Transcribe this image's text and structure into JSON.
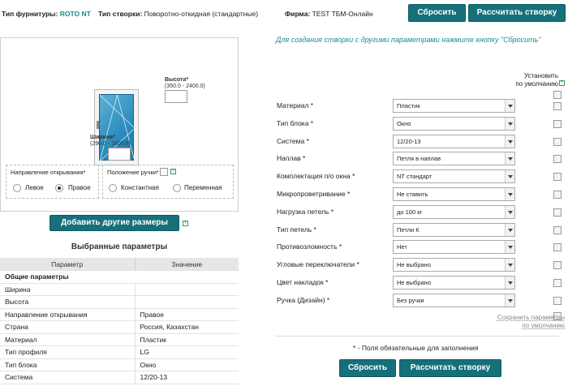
{
  "top": {
    "fittings_label": "Тип фурнитуры:",
    "fittings_value": "ROTO NT",
    "sash_type_label": "Тип створки:",
    "sash_type_value": "Поворотно-откидная (стандартные)",
    "company_label": "Фирма:",
    "company_value": "TEST ТБМ-Онлайн",
    "reset_label": "Сбросить",
    "calc_label": "Рассчитать створку"
  },
  "window": {
    "height_label": "Высота*",
    "height_range": "(350.0 - 2400.0)",
    "width_label": "Ширина*",
    "width_range": "(290.0 - 1600.0)",
    "direction_title": "Направление открывания*",
    "direction_left": "Левое",
    "direction_right": "Правое",
    "handle_title": "Положение ручки*",
    "handle_const": "Константная",
    "handle_var": "Переменная",
    "add_sizes_label": "Добавить другие размеры"
  },
  "selected": {
    "title": "Выбранные параметры",
    "col_param": "Параметр",
    "col_value": "Значение",
    "section": "Общие параметры",
    "rows": [
      {
        "param": "Ширина",
        "value": ""
      },
      {
        "param": "Высота",
        "value": ""
      },
      {
        "param": "Направление открывания",
        "value": "Правое"
      },
      {
        "param": "Страна",
        "value": "Россия, Казахстан"
      },
      {
        "param": "Материал",
        "value": "Пластик"
      },
      {
        "param": "Тип профиля",
        "value": "LG"
      },
      {
        "param": "Тип блока",
        "value": "Окно"
      },
      {
        "param": "Система",
        "value": "12/20-13"
      }
    ]
  },
  "form": {
    "hint": "Для создания створки с другими параметрами нажмите кнопку \"Сбросить\"",
    "defaults_head_1": "Установить",
    "defaults_head_2": "по умолчанию",
    "fields": [
      {
        "label": "Материал *",
        "value": "Пластик"
      },
      {
        "label": "Тип блока *",
        "value": "Окно"
      },
      {
        "label": "Система *",
        "value": "12/20-13"
      },
      {
        "label": "Наплав *",
        "value": "Петля в наплав"
      },
      {
        "label": "Комплектация п/о окна *",
        "value": "NT стандарт"
      },
      {
        "label": "Микропроветривание *",
        "value": "Не ставить"
      },
      {
        "label": "Нагрузка петель *",
        "value": "до 100 кг"
      },
      {
        "label": "Тип петель *",
        "value": "Петли К"
      },
      {
        "label": "Противозломность *",
        "value": "Нет"
      },
      {
        "label": "Угловые переключатели *",
        "value": "Не выбрано"
      },
      {
        "label": "Цвет накладок *",
        "value": "Не выбрано"
      },
      {
        "label": "Ручка (Дизайн) *",
        "value": "Без ручки"
      }
    ],
    "save_defaults_1": "Сохранить параметры",
    "save_defaults_2": "по умолчанию",
    "required_note": "* - Поля обязательные для заполнения",
    "reset_label": "Сбросить",
    "calc_label": "Рассчитать створку"
  }
}
